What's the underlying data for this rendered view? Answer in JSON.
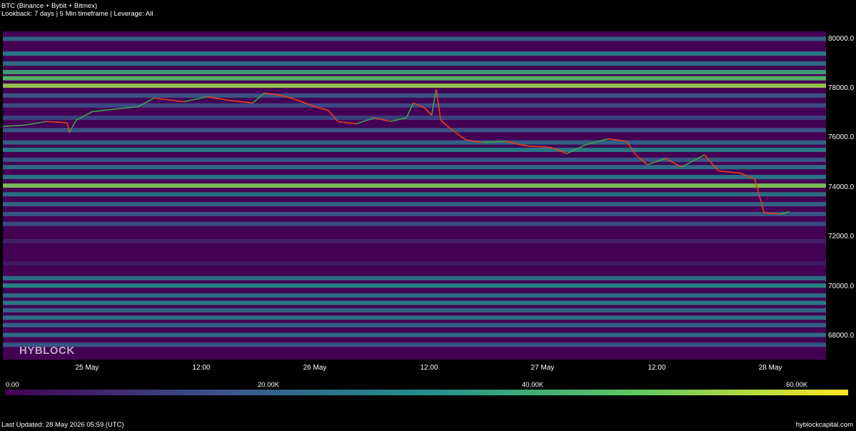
{
  "header": {
    "title": "BTC (Binance + Bybit + Bitmex)",
    "subtitle": "Lookback: 7 days | 5 Min timeframe | Leverage: All"
  },
  "watermark": "HYBLOCK",
  "footer": {
    "updated": "Last Updated: 28 May 2026 05:59 (UTC)",
    "site": "hyblockcapital.com"
  },
  "colors": {
    "background": "#000000",
    "scale": [
      "#440154",
      "#3b528b",
      "#21918c",
      "#5ec962",
      "#fde725"
    ],
    "price_up": "#3fa34d",
    "price_down": "#e8411e"
  },
  "chart_data": {
    "type": "heatmap",
    "title": "BTC (Binance + Bybit + Bitmex)",
    "ylim": [
      67000,
      80300
    ],
    "y_ticks": [
      "80000.0",
      "78000.0",
      "76000.0",
      "74000.0",
      "72000.0",
      "70000.0",
      "68000.0"
    ],
    "y_tick_values": [
      80000,
      78000,
      76000,
      74000,
      72000,
      70000,
      68000
    ],
    "x_ticks": [
      "25 May",
      "12:00",
      "26 May",
      "12:00",
      "27 May",
      "12:00",
      "28 May"
    ],
    "x_tick_values": [
      0.5,
      1.0,
      1.5,
      2.0,
      2.5,
      3.0,
      3.5
    ],
    "x_range_days": [
      0.16,
      3.75
    ],
    "colorbar": {
      "ticks": [
        "0.00",
        "20.00K",
        "40.00K",
        "60.00K"
      ],
      "tick_values": [
        0,
        20000,
        40000,
        60000
      ],
      "range": [
        0,
        66000
      ]
    },
    "levels": [
      {
        "price": 80000,
        "intensity": 0.35
      },
      {
        "price": 79400,
        "intensity": 0.45
      },
      {
        "price": 79000,
        "intensity": 0.4
      },
      {
        "price": 78650,
        "intensity": 0.62
      },
      {
        "price": 78400,
        "intensity": 0.72
      },
      {
        "price": 78100,
        "intensity": 0.85
      },
      {
        "price": 77700,
        "intensity": 0.3
      },
      {
        "price": 77300,
        "intensity": 0.25
      },
      {
        "price": 76800,
        "intensity": 0.22
      },
      {
        "price": 76300,
        "intensity": 0.3
      },
      {
        "price": 75800,
        "intensity": 0.35
      },
      {
        "price": 75500,
        "intensity": 0.45
      },
      {
        "price": 75100,
        "intensity": 0.3
      },
      {
        "price": 74800,
        "intensity": 0.38
      },
      {
        "price": 74400,
        "intensity": 0.42
      },
      {
        "price": 74050,
        "intensity": 0.8
      },
      {
        "price": 73700,
        "intensity": 0.4
      },
      {
        "price": 73300,
        "intensity": 0.35
      },
      {
        "price": 72900,
        "intensity": 0.3
      },
      {
        "price": 72500,
        "intensity": 0.25
      },
      {
        "price": 71800,
        "intensity": 0.1
      },
      {
        "price": 70900,
        "intensity": 0.08
      },
      {
        "price": 70300,
        "intensity": 0.4
      },
      {
        "price": 70000,
        "intensity": 0.5
      },
      {
        "price": 69600,
        "intensity": 0.4
      },
      {
        "price": 69300,
        "intensity": 0.45
      },
      {
        "price": 69000,
        "intensity": 0.35
      },
      {
        "price": 68700,
        "intensity": 0.4
      },
      {
        "price": 68400,
        "intensity": 0.35
      },
      {
        "price": 68000,
        "intensity": 0.4
      },
      {
        "price": 67600,
        "intensity": 0.3
      }
    ],
    "price_series": {
      "name": "BTC",
      "points": [
        [
          0.16,
          76450
        ],
        [
          0.25,
          76500
        ],
        [
          0.35,
          76650
        ],
        [
          0.44,
          76600
        ],
        [
          0.45,
          76200
        ],
        [
          0.48,
          76700
        ],
        [
          0.55,
          77050
        ],
        [
          0.65,
          77150
        ],
        [
          0.75,
          77250
        ],
        [
          0.82,
          77600
        ],
        [
          0.95,
          77450
        ],
        [
          1.05,
          77650
        ],
        [
          1.15,
          77500
        ],
        [
          1.25,
          77400
        ],
        [
          1.3,
          77800
        ],
        [
          1.38,
          77700
        ],
        [
          1.45,
          77500
        ],
        [
          1.52,
          77250
        ],
        [
          1.58,
          77100
        ],
        [
          1.62,
          76650
        ],
        [
          1.7,
          76550
        ],
        [
          1.78,
          76800
        ],
        [
          1.85,
          76650
        ],
        [
          1.92,
          76800
        ],
        [
          1.95,
          77400
        ],
        [
          2.0,
          77200
        ],
        [
          2.03,
          76900
        ],
        [
          2.05,
          77950
        ],
        [
          2.07,
          76700
        ],
        [
          2.12,
          76300
        ],
        [
          2.18,
          75900
        ],
        [
          2.25,
          75800
        ],
        [
          2.35,
          75850
        ],
        [
          2.45,
          75650
        ],
        [
          2.55,
          75600
        ],
        [
          2.62,
          75350
        ],
        [
          2.7,
          75700
        ],
        [
          2.8,
          75950
        ],
        [
          2.88,
          75850
        ],
        [
          2.92,
          75300
        ],
        [
          2.97,
          74900
        ],
        [
          3.05,
          75150
        ],
        [
          3.12,
          74800
        ],
        [
          3.22,
          75300
        ],
        [
          3.28,
          74650
        ],
        [
          3.38,
          74550
        ],
        [
          3.44,
          74300
        ],
        [
          3.48,
          72950
        ],
        [
          3.55,
          72900
        ],
        [
          3.59,
          73000
        ]
      ]
    }
  }
}
